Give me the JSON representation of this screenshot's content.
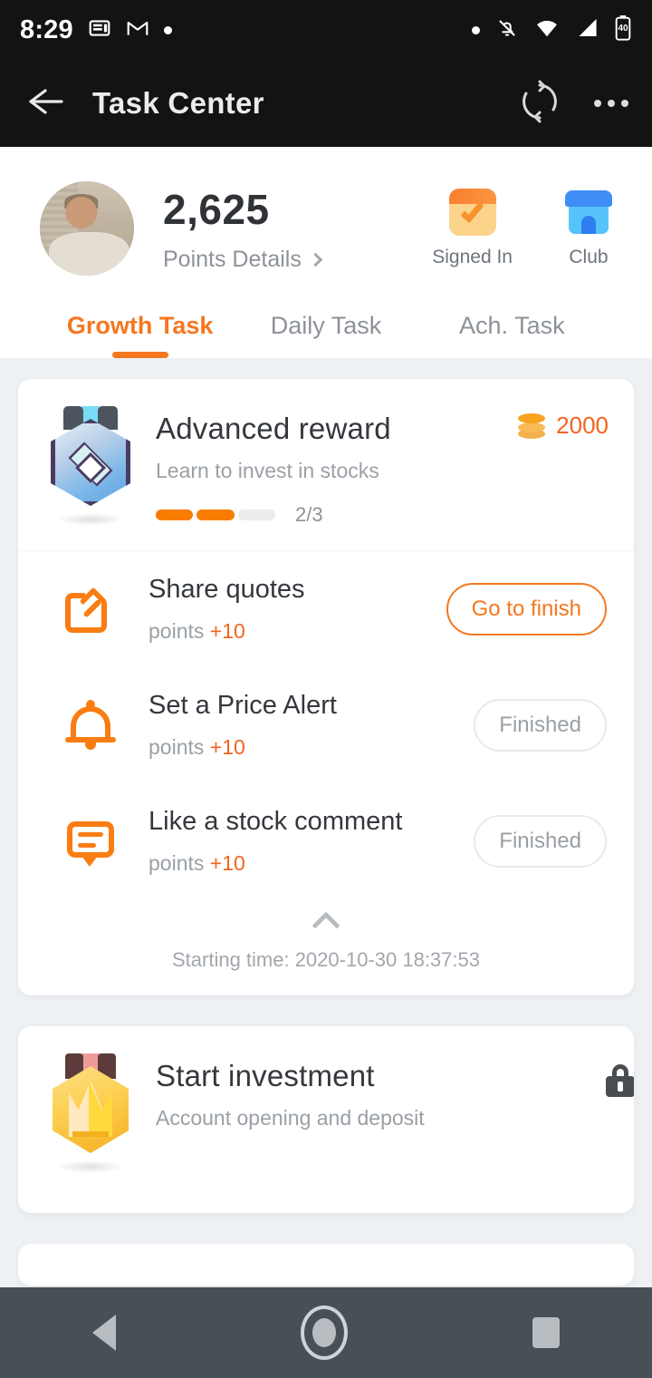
{
  "statusbar": {
    "time": "8:29",
    "left_icons": [
      "news-icon",
      "gmail-icon",
      "dot-icon"
    ],
    "right_icons": [
      "dot-icon",
      "notifications-off-icon",
      "wifi-icon",
      "signal-icon",
      "battery-icon"
    ],
    "battery_level": "40"
  },
  "appbar": {
    "title": "Task Center",
    "back_icon": "back-arrow-icon",
    "refresh_icon": "refresh-icon",
    "overflow_icon": "more-options-icon"
  },
  "profile": {
    "points": "2,625",
    "points_details_label": "Points Details",
    "actions": [
      {
        "label": "Signed In",
        "icon": "signed-in-icon"
      },
      {
        "label": "Club",
        "icon": "club-icon"
      }
    ]
  },
  "tabs": [
    {
      "label": "Growth Task",
      "active": true
    },
    {
      "label": "Daily Task",
      "active": false
    },
    {
      "label": "Ach. Task",
      "active": false
    }
  ],
  "cards": [
    {
      "title": "Advanced reward",
      "subtitle": "Learn to invest in stocks",
      "badge_icon": "gem-badge-icon",
      "reward_icon": "coin-icon",
      "reward_value": "2000",
      "progress_text": "2/3",
      "progress_done": 2,
      "progress_total": 3,
      "tasks": [
        {
          "icon": "share-icon",
          "title": "Share quotes",
          "points_label": "points",
          "points_value": "+10",
          "action_label": "Go to finish",
          "action_state": "go"
        },
        {
          "icon": "bell-icon",
          "title": "Set a Price Alert",
          "points_label": "points",
          "points_value": "+10",
          "action_label": "Finished",
          "action_state": "done"
        },
        {
          "icon": "comment-icon",
          "title": "Like a stock comment",
          "points_label": "points",
          "points_value": "+10",
          "action_label": "Finished",
          "action_state": "done"
        }
      ],
      "collapse_icon": "chevron-up-icon",
      "footer_text": "Starting time: 2020-10-30 18:37:53"
    },
    {
      "title": "Start investment",
      "subtitle": "Account opening and deposit",
      "badge_icon": "crown-badge-icon",
      "lock_icon": "lock-icon"
    }
  ],
  "navbar": {
    "back": "back-nav-icon",
    "home": "home-nav-icon",
    "recents": "recents-nav-icon"
  },
  "colors": {
    "accent": "#f5771f",
    "reward": "#f4641f",
    "progress_fill": "#f87c00",
    "icon_orange": "#f97d12",
    "page_bg": "#eef1f4",
    "appbar_bg": "#131313",
    "navbar_bg": "#474f57"
  }
}
